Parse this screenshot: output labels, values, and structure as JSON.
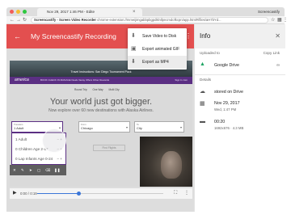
{
  "window": {
    "tab_title": "Nov 29, 2017 1:46 PM - Edite",
    "profile": "Screencastify",
    "address_prefix": "Screencastify - Screen Video Recorder",
    "address_url": "chrome-extension://mmeijimgabbpbgpdklnllpncmdofkcpn/app.html#/files/aH7bYd..."
  },
  "app_bar": {
    "title": "My Screencastify Recording"
  },
  "menu": {
    "items": [
      {
        "label": "Save Video to Disk",
        "icon": "download-icon"
      },
      {
        "label": "Export animated GIF",
        "icon": "gif-icon"
      },
      {
        "label": "Export as MP4",
        "icon": "download-icon"
      }
    ]
  },
  "video": {
    "hero_caption": "Travel Instructions: San Diego Tournament Pack",
    "site_logo": "america",
    "nav_links": "BOOK  CHECK IN  MANAGE  Deals  Vacay Offers  Other Rewards",
    "nav_right": "Sign In  Join",
    "trip_tabs": [
      "Round Trip",
      "One Way",
      "Multi City"
    ],
    "headline": "Your world just got bigger.",
    "subhead": "Now explore over 60 new destinations with Alaska Airlines.",
    "form": {
      "traveler_label": "Travelers",
      "traveler_value": "1 Adult",
      "destination_label": "From",
      "destination_value": "Chicago",
      "start_label": "To",
      "start_value": "City",
      "find_button": "Find Flights"
    },
    "popup_rows": [
      {
        "label": "1 Adult",
        "controls": "−  +"
      },
      {
        "label": "0 Children Age 2-17",
        "controls": "−  +"
      },
      {
        "label": "0 Lap Infants Age 0-24",
        "controls": "−  +"
      }
    ]
  },
  "player": {
    "current_time": "0:00 / 0:19",
    "progress": 0.33
  },
  "info": {
    "title": "Info",
    "uploaded_to_label": "Uploaded to",
    "copy_link": "Copy Link",
    "service": "Google Drive",
    "details_label": "Details",
    "stored_label": "stored on Drive",
    "date": "Nov 29, 2017",
    "date_time": "Wed, 1:47 PM",
    "duration": "00:20",
    "resolution_size": "1692x676 · 4.3 MB"
  }
}
